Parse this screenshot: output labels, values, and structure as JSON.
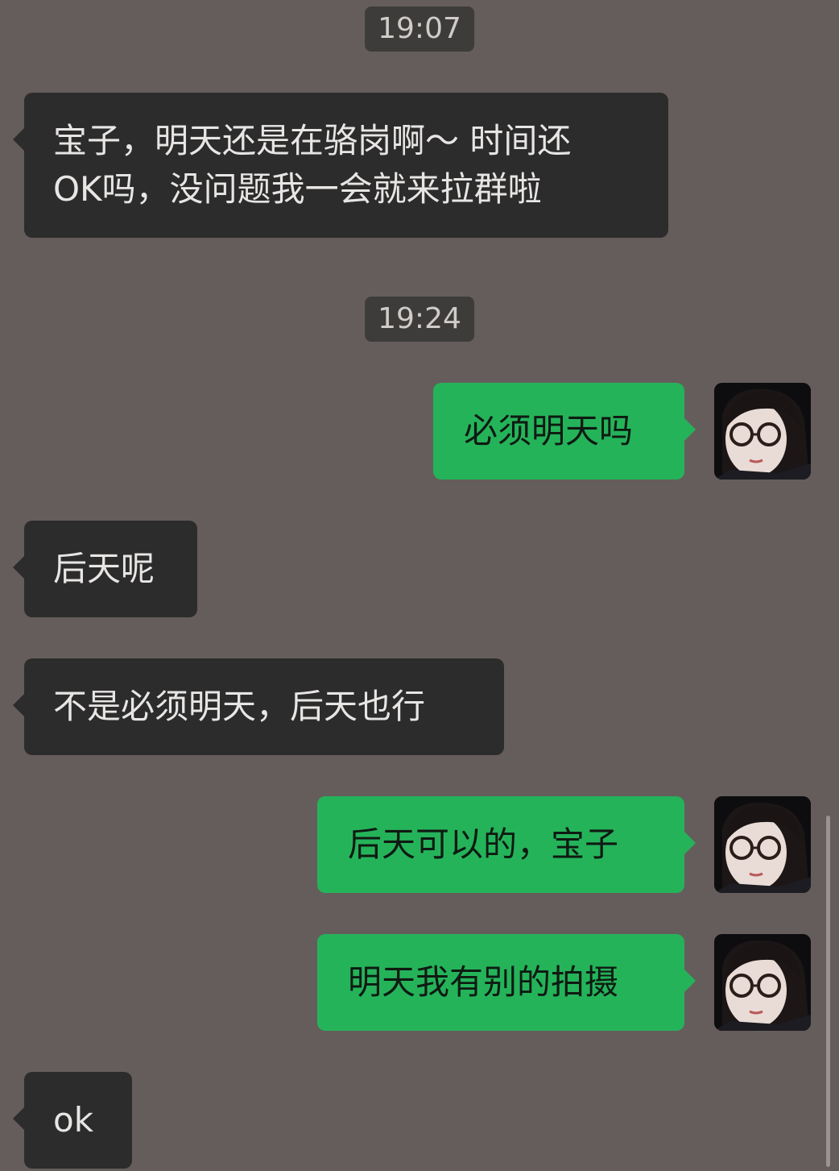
{
  "timestamps": [
    "19:07",
    "19:24"
  ],
  "messages": [
    {
      "side": "in",
      "text_lines": [
        "宝子，明天还是在骆岗啊～ 时间还",
        "OK吗，没问题我一会就来拉群啦"
      ]
    },
    {
      "side": "out",
      "text": "必须明天吗"
    },
    {
      "side": "in",
      "text": "后天呢"
    },
    {
      "side": "in",
      "text": "不是必须明天，后天也行"
    },
    {
      "side": "out",
      "text": "后天可以的，宝子"
    },
    {
      "side": "out",
      "text": "明天我有别的拍摄"
    },
    {
      "side": "in",
      "text": "ok"
    }
  ],
  "avatar": {
    "icon": "user-avatar-photo"
  },
  "colors": {
    "background": "#655d5b",
    "incoming_bubble": "#2d2c2c",
    "outgoing_bubble": "#25b35a",
    "timestamp_bg": "#3e3c3b"
  }
}
